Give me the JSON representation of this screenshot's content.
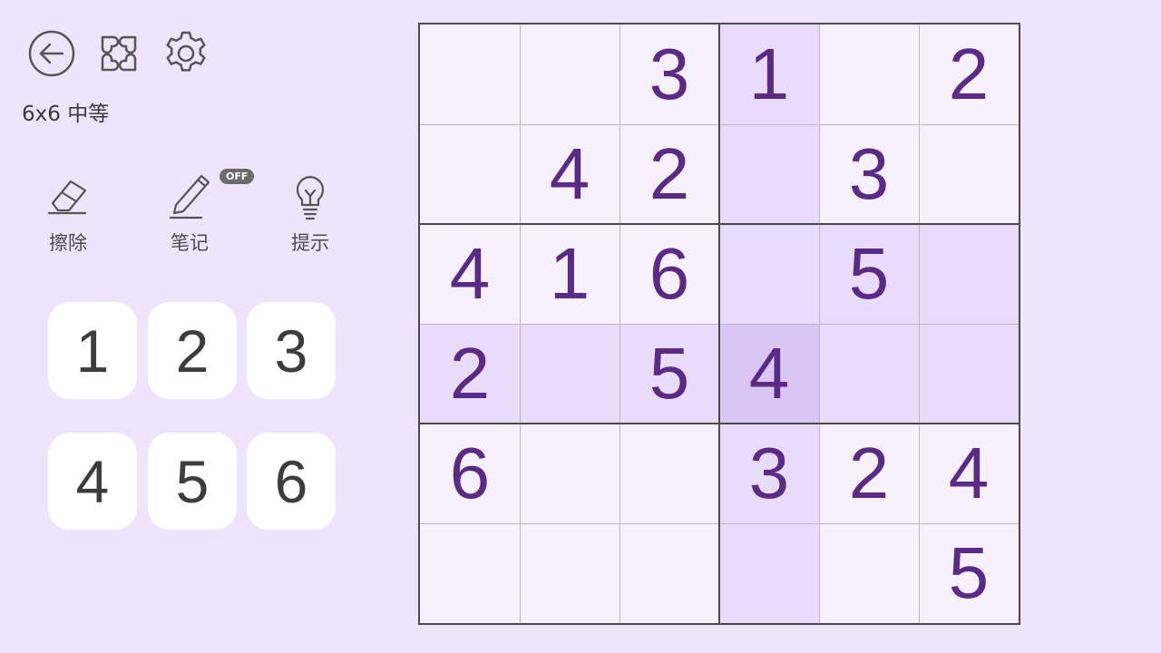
{
  "header": {
    "back_icon": "back-arrow-icon",
    "layout_icon": "clover-grid-icon",
    "settings_icon": "gear-icon"
  },
  "difficulty_label": "6x6 中等",
  "tools": {
    "erase_label": "擦除",
    "notes_label": "笔记",
    "notes_badge": "OFF",
    "hint_label": "提示"
  },
  "numpad": [
    "1",
    "2",
    "3",
    "4",
    "5",
    "6"
  ],
  "board": {
    "size": 6,
    "box_rows": 2,
    "box_cols": 3,
    "selected": [
      3,
      3
    ],
    "cells": [
      [
        "",
        "",
        "3",
        "1",
        "",
        "2"
      ],
      [
        "",
        "4",
        "2",
        "",
        "3",
        ""
      ],
      [
        "4",
        "1",
        "6",
        "",
        "5",
        ""
      ],
      [
        "2",
        "",
        "5",
        "4",
        "",
        ""
      ],
      [
        "6",
        "",
        "",
        "3",
        "2",
        "4"
      ],
      [
        "",
        "",
        "",
        "",
        "",
        "5"
      ]
    ]
  },
  "colors": {
    "background": "#EEE5FC",
    "cell": "#F7F0FD",
    "highlight": "#E9DCFB",
    "selected": "#D9C6F2",
    "digit": "#5B2A86"
  }
}
